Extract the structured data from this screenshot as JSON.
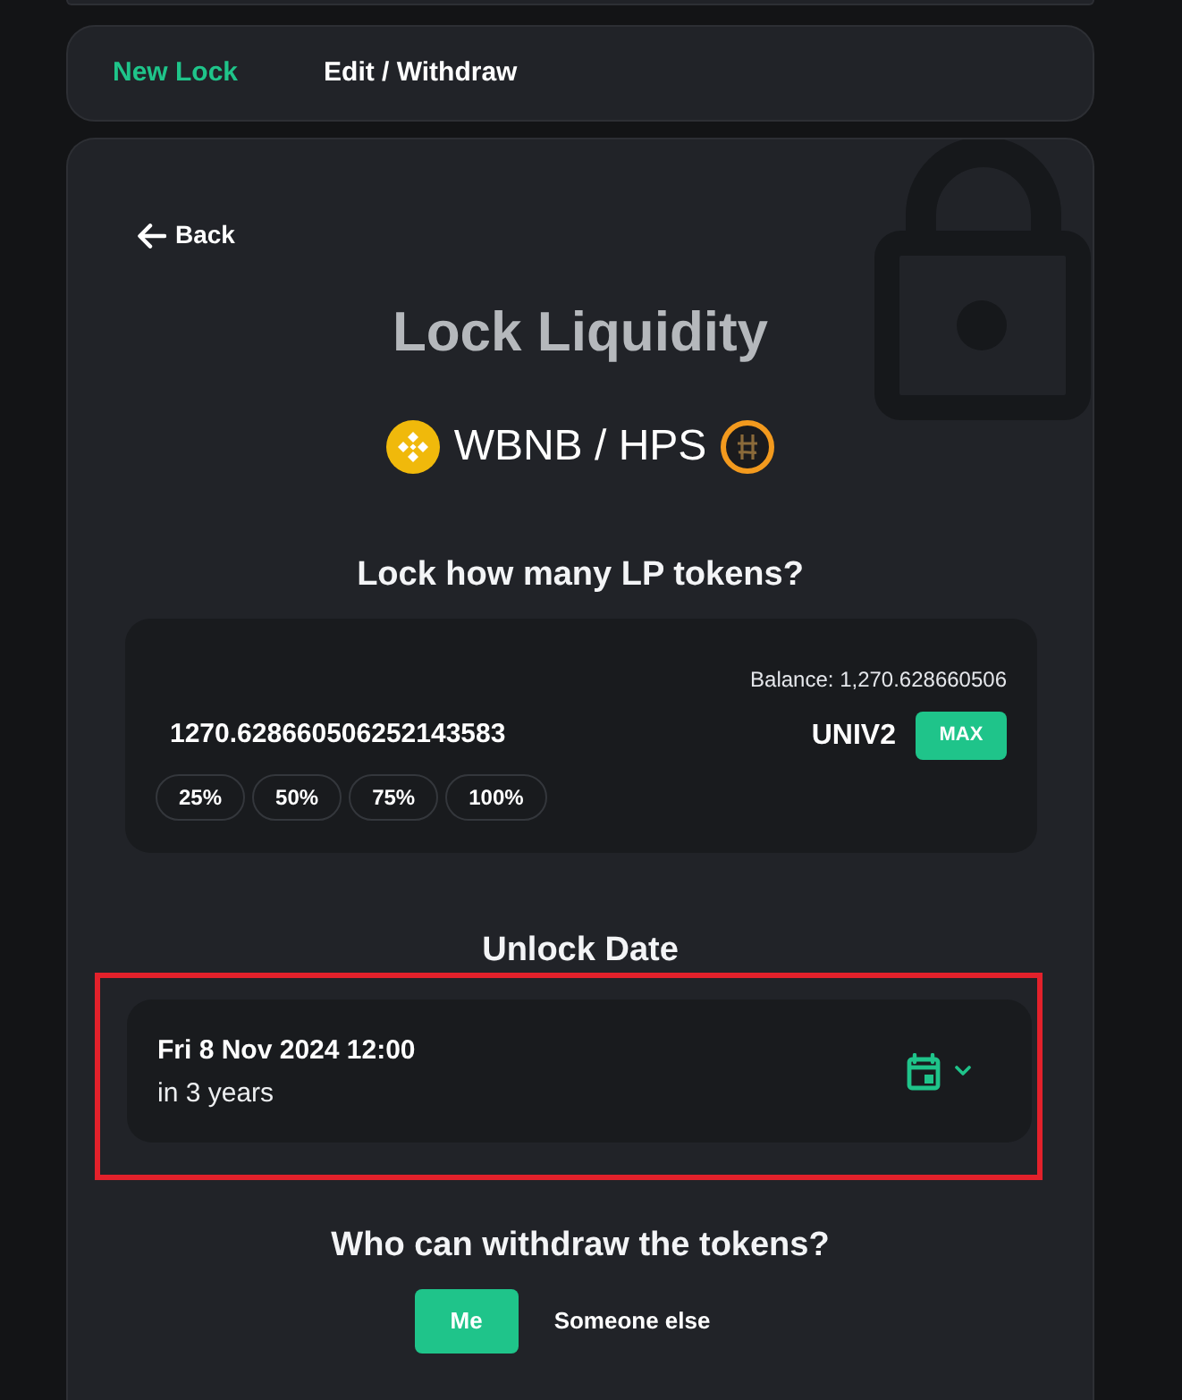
{
  "tabs": [
    {
      "label": "New Lock",
      "selected": true
    },
    {
      "label": "Edit / Withdraw",
      "selected": false
    }
  ],
  "back": {
    "label": "Back"
  },
  "title": "Lock Liquidity",
  "pair": {
    "label": "WBNB / HPS"
  },
  "amount_section": {
    "heading": "Lock how many LP tokens?",
    "balance": "Balance: 1,270.628660506",
    "value": "1270.628660506252143583",
    "token": "UNIV2",
    "max_button": "MAX",
    "percent_buttons": [
      "25%",
      "50%",
      "75%",
      "100%"
    ]
  },
  "unlock_section": {
    "heading": "Unlock Date",
    "date": "Fri 8 Nov 2024 12:00",
    "relative": "in 3 years",
    "highlighted": true
  },
  "withdrawer_section": {
    "heading": "Who can withdraw the tokens?",
    "options": [
      {
        "label": "Me",
        "selected": true
      },
      {
        "label": "Someone else",
        "selected": false
      }
    ]
  }
}
